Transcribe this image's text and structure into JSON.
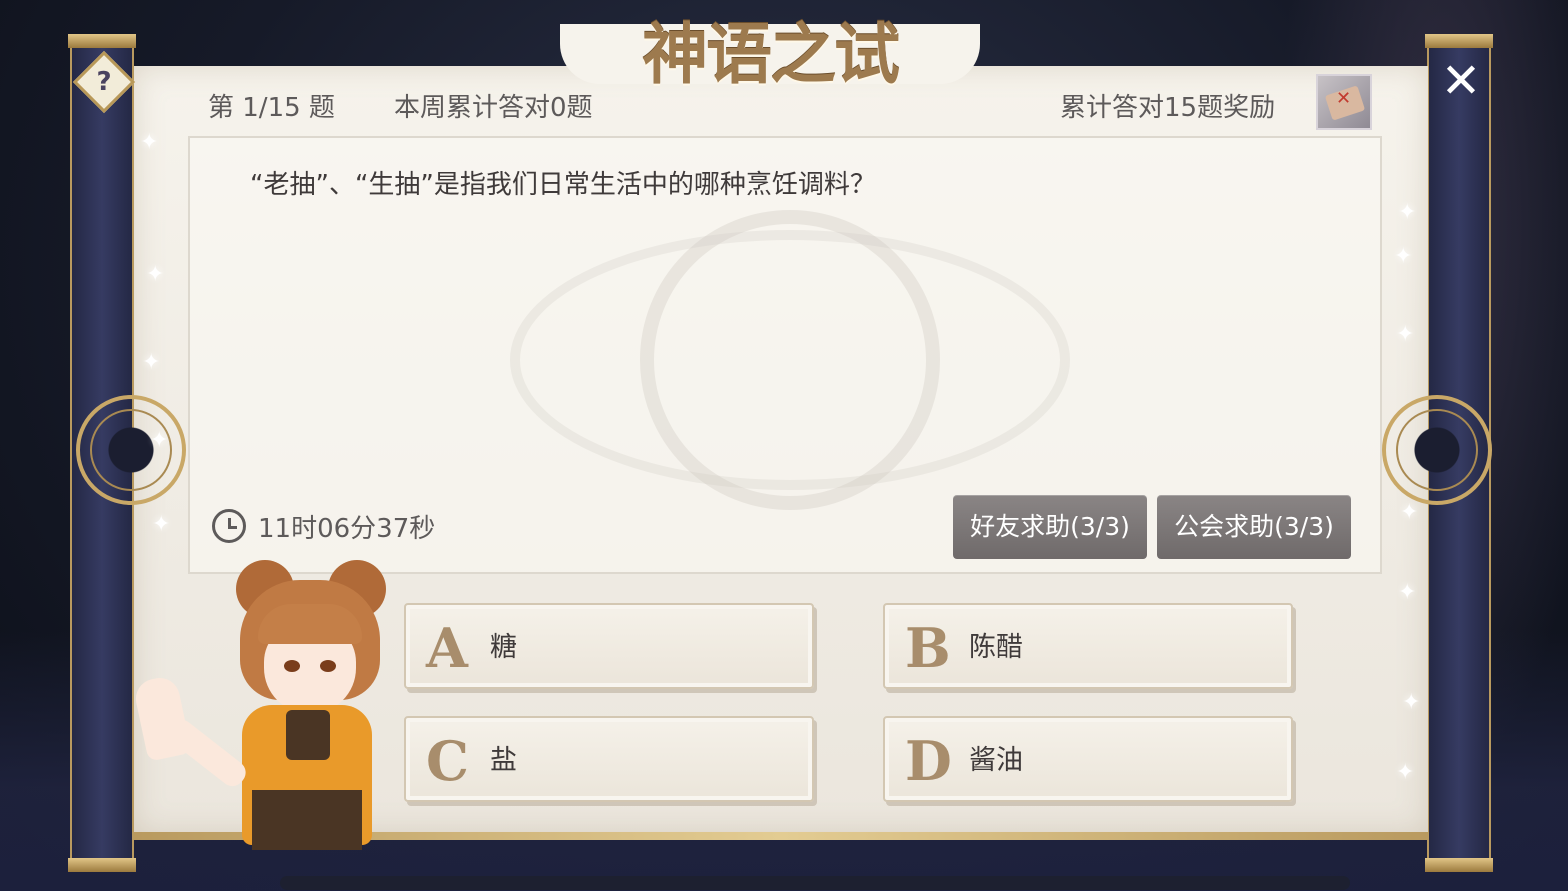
{
  "title": "神语之试",
  "header": {
    "question_number": "第 1/15 题",
    "week_correct": "本周累计答对0题",
    "reward_label": "累计答对15题奖励"
  },
  "icons": {
    "help": "?",
    "close": "✕",
    "sparkle": "✦"
  },
  "question": {
    "text": "“老抽”、“生抽”是指我们日常生活中的哪种烹饪调料？",
    "timer": "11时06分37秒"
  },
  "help_buttons": {
    "friend": "好友求助(3/3)",
    "guild": "公会求助(3/3)"
  },
  "options": [
    {
      "letter": "A",
      "text": "糖"
    },
    {
      "letter": "B",
      "text": "陈醋"
    },
    {
      "letter": "C",
      "text": "盐"
    },
    {
      "letter": "D",
      "text": "酱油"
    }
  ],
  "colors": {
    "paper": "#f6f3ec",
    "gold": "#b99a5f",
    "pillar": "#363b62",
    "help_button": "#7f7a7a",
    "option_letter": "#a88d6c"
  }
}
